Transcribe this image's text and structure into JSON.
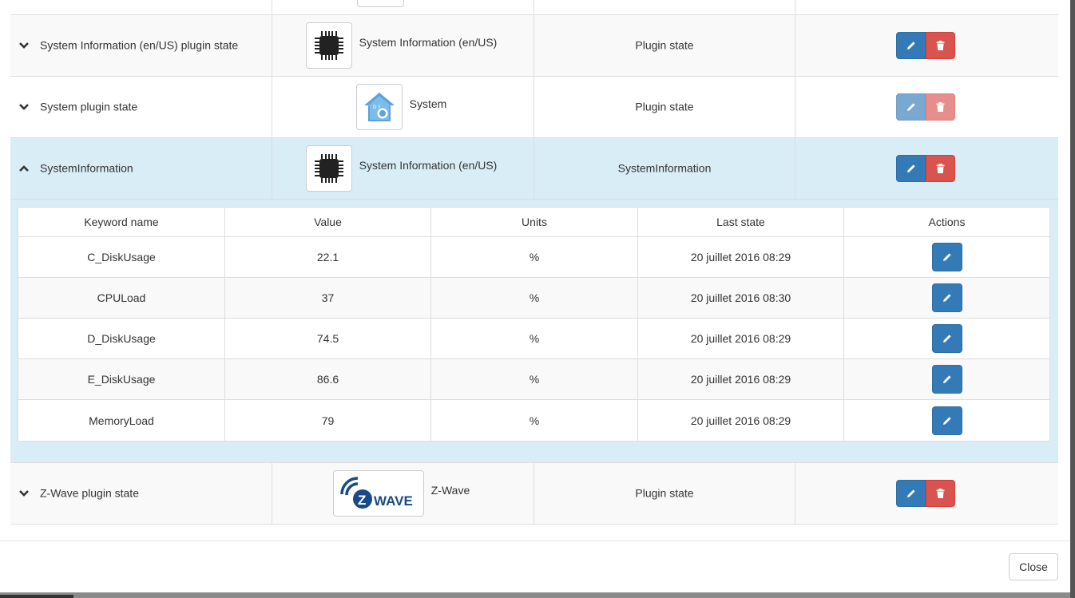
{
  "device_rows": [
    {
      "name": "System Information (en/US) plugin state",
      "plugin_name": "System Information (en/US)",
      "plugin_icon": "cpu-chip-icon",
      "type": "Plugin state",
      "expanded": false
    },
    {
      "name": "System plugin state",
      "plugin_name": "System",
      "plugin_icon": "yadoms-house-icon",
      "type": "Plugin state",
      "expanded": false
    },
    {
      "name": "SystemInformation",
      "plugin_name": "System Information (en/US)",
      "plugin_icon": "cpu-chip-icon",
      "type": "SystemInformation",
      "expanded": true
    },
    {
      "name": "Z-Wave plugin state",
      "plugin_name": "Z-Wave",
      "plugin_icon": "zwave-logo-icon",
      "type": "Plugin state",
      "expanded": false
    }
  ],
  "keywords": {
    "headers": [
      "Keyword name",
      "Value",
      "Units",
      "Last state",
      "Actions"
    ],
    "rows": [
      {
        "name": "C_DiskUsage",
        "value": "22.1",
        "units": "%",
        "last_state": "20 juillet 2016 08:29"
      },
      {
        "name": "CPULoad",
        "value": "37",
        "units": "%",
        "last_state": "20 juillet 2016 08:30"
      },
      {
        "name": "D_DiskUsage",
        "value": "74.5",
        "units": "%",
        "last_state": "20 juillet 2016 08:29"
      },
      {
        "name": "E_DiskUsage",
        "value": "86.6",
        "units": "%",
        "last_state": "20 juillet 2016 08:29"
      },
      {
        "name": "MemoryLoad",
        "value": "79",
        "units": "%",
        "last_state": "20 juillet 2016 08:29"
      }
    ]
  },
  "footer": {
    "close_label": "Close"
  },
  "colors": {
    "primary": "#337ab7",
    "danger": "#d9534f",
    "active_row": "#d9edf7"
  },
  "icons": {
    "edit": "pencil-icon",
    "delete": "trash-icon",
    "collapsed": "chevron-down-icon",
    "expanded": "chevron-up-icon",
    "zwave_logo_text": "WAVE"
  }
}
